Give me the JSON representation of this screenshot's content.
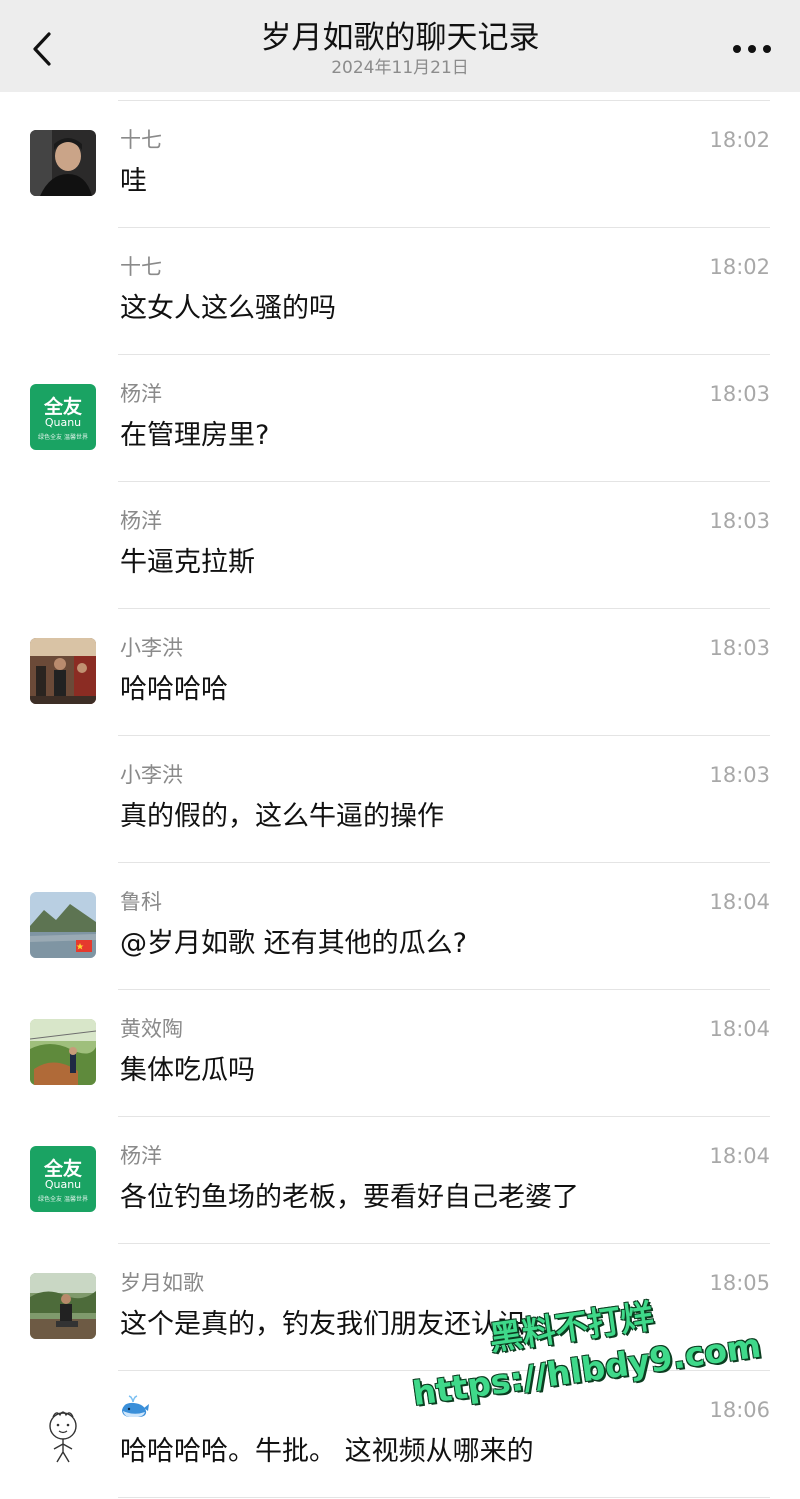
{
  "header": {
    "title": "岁月如歌的聊天记录",
    "date": "2024年11月21日"
  },
  "messages": [
    {
      "sender": "十七",
      "time": "18:02",
      "text": "哇",
      "avatar": "photo-man-avatar"
    },
    {
      "sender": "十七",
      "time": "18:02",
      "text": "这女人这么骚的吗",
      "avatar": ""
    },
    {
      "sender": "杨洋",
      "time": "18:03",
      "text": "在管理房里?",
      "avatar": "quanyou-logo-avatar"
    },
    {
      "sender": "杨洋",
      "time": "18:03",
      "text": "牛逼克拉斯",
      "avatar": ""
    },
    {
      "sender": "小李洪",
      "time": "18:03",
      "text": "哈哈哈哈",
      "avatar": "gym-photo-avatar"
    },
    {
      "sender": "小李洪",
      "time": "18:03",
      "text": "真的假的，这么牛逼的操作",
      "avatar": ""
    },
    {
      "sender": "鲁科",
      "time": "18:04",
      "text": "@岁月如歌 还有其他的瓜么?",
      "avatar": "lake-landscape-avatar"
    },
    {
      "sender": "黄效陶",
      "time": "18:04",
      "text": "集体吃瓜吗",
      "avatar": "garden-photo-avatar"
    },
    {
      "sender": "杨洋",
      "time": "18:04",
      "text": "各位钓鱼场的老板，要看好自己老婆了",
      "avatar": "quanyou-logo-avatar"
    },
    {
      "sender": "岁月如歌",
      "time": "18:05",
      "text": "这个是真的，钓友我们朋友还认识",
      "avatar": "outdoor-person-avatar"
    },
    {
      "sender": "🐋",
      "time": "18:06",
      "text": "哈哈哈哈。牛批。 这视频从哪来的",
      "avatar": "cartoon-doodle-avatar"
    }
  ],
  "quanyou_logo": {
    "big": "全友",
    "sub": "Quanu",
    "tiny": "绿色全友 温馨世界"
  },
  "watermark": {
    "line1": "黑料不打烊",
    "line2": "https://hlbdy9.com"
  },
  "colors": {
    "header_bg": "#ededed",
    "quanyou_green": "#1aa363",
    "watermark_green": "#3fd98a"
  }
}
